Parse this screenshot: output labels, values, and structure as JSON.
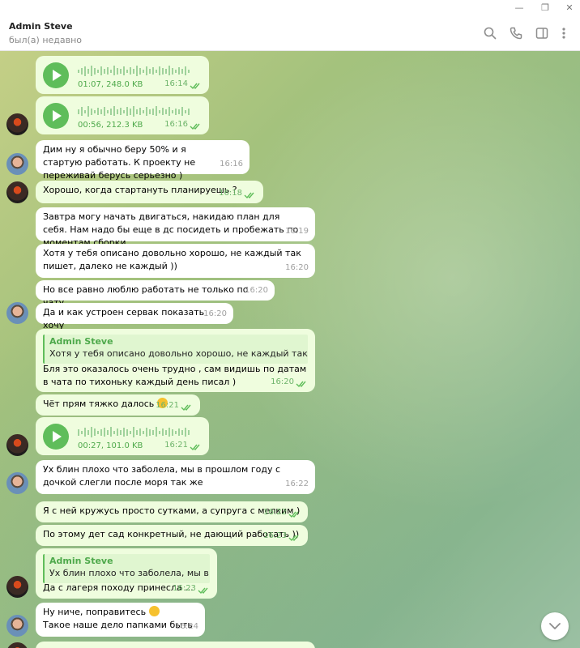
{
  "window": {
    "min": "—",
    "restore": "❐",
    "close": "✕"
  },
  "header": {
    "name": "Admin Steve",
    "status": "был(а) недавно"
  },
  "messages": {
    "v1": {
      "meta": "01:07, 248.0 KB",
      "time": "16:14"
    },
    "v2": {
      "meta": "00:56, 212.3 KB",
      "time": "16:16"
    },
    "m3": {
      "text": "Дим ну я обычно беру 50% и я стартую работать. К проекту не переживай берусь серьезно )",
      "time": "16:16"
    },
    "m4": {
      "text": "Хорошо, когда стартануть планируешь ?",
      "time": "16:18"
    },
    "m5": {
      "text": "Завтра могу начать двигаться, накидаю план для себя. Нам надо бы еще в дс посидеть и пробежать по моментам сборки",
      "time": "16:19"
    },
    "m6": {
      "text": "Хотя у тебя описано довольно хорошо, не каждый так пишет, далеко не каждый ))",
      "time": "16:20"
    },
    "m7": {
      "text": "Но все равно люблю работать не только по чату",
      "time": "16:20"
    },
    "m8": {
      "text": "Да и как устроен сервак показать хочу",
      "time": "16:20"
    },
    "m9": {
      "reply_name": "Admin Steve",
      "reply_text": "Хотя у тебя описано довольно хорошо, не каждый так пише...",
      "text": "Бля это оказалось очень трудно , сам видишь по датам в чата по тихоньку каждый день писал )",
      "time": "16:20"
    },
    "m10": {
      "text": "Чёт прям тяжко далось",
      "time": "16:21"
    },
    "v3": {
      "meta": "00:27, 101.0 KB",
      "time": "16:21"
    },
    "m12": {
      "text": "Ух блин плохо что заболела, мы в прошлом году с дочкой слегли после моря так же",
      "time": "16:22"
    },
    "m13": {
      "text": "Я с ней кружусь просто сутками, а супруга с мелким )",
      "time": "16:22"
    },
    "m14": {
      "text": "По этому дет сад конкретный, не дающий работать ))",
      "time": "16:23"
    },
    "m15": {
      "reply_name": "Admin Steve",
      "reply_text": "Ух блин плохо что заболела, мы в пр...",
      "text": "Да с лагеря походу принесла ...",
      "time": "16:23"
    },
    "m16": {
      "text": "Ну ниче, поправитесь",
      "text2": "Такое наше дело папками быть",
      "time": "16:24"
    }
  },
  "icons": [
    "search-icon",
    "phone-icon",
    "sidebar-icon",
    "more-icon",
    "play-icon",
    "double-check-icon",
    "chevron-down-icon"
  ],
  "colors": {
    "accent": "#5fbd5a",
    "outgoing_bubble": "#effdde",
    "incoming_bubble": "#ffffff"
  }
}
